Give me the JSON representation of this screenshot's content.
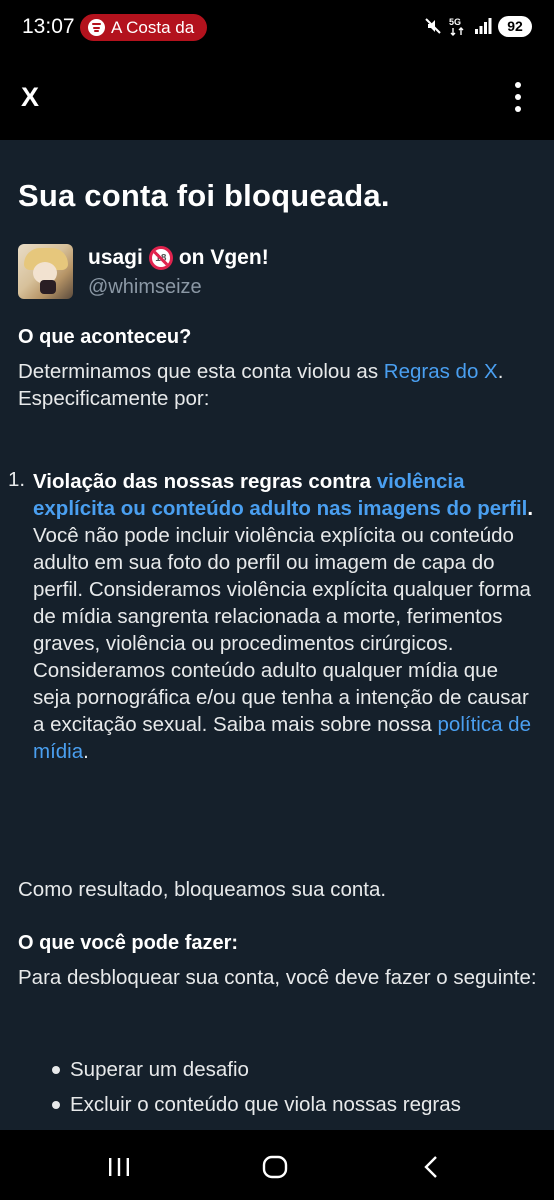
{
  "status_bar": {
    "time": "13:07",
    "media_app": "A Costa da",
    "network_label": "5G",
    "battery": "92",
    "icons": [
      "spotify-icon",
      "mute-icon",
      "5g-icon",
      "signal-icon",
      "battery-icon"
    ]
  },
  "header": {
    "close_label": "X",
    "menu_icon": "more-vert-icon"
  },
  "page": {
    "title": "Sua conta foi bloqueada."
  },
  "account": {
    "name": "usagi",
    "name_suffix": "on Vgen!",
    "emoji_icon": "no-under-18-icon",
    "emoji_text": "18",
    "handle": "@whimseize"
  },
  "what_happened": {
    "heading": "O que aconteceu?",
    "text_before": "Determinamos que esta conta violou as ",
    "link": "Regras do X",
    "text_after": ". Especificamente por:"
  },
  "violation": {
    "number": "1.",
    "title_text": "Violação das nossas regras contra ",
    "title_link": "violência explícita ou conteúdo adulto nas imagens do perfil",
    "title_end": ".",
    "description": "Você não pode incluir violência explícita ou conteúdo adulto em sua foto do perfil ou imagem de capa do perfil. Consideramos violência explícita qualquer forma de mídia sangrenta relacionada a morte, ferimentos graves, violência ou procedimentos cirúrgicos. Consideramos conteúdo adulto qualquer mídia que seja pornográfica e/ou que tenha a intenção de causar a excitação sexual. Saiba mais sobre nossa ",
    "desc_link": "política de mídia",
    "desc_end": "."
  },
  "result": {
    "text": "Como resultado, bloqueamos sua conta."
  },
  "what_you_can_do": {
    "heading": "O que você pode fazer:",
    "text": "Para desbloquear sua conta, você deve fazer o seguinte:",
    "bullets": [
      "Superar um desafio",
      "Excluir o conteúdo que viola nossas regras"
    ]
  },
  "colors": {
    "background": "#15202b",
    "link": "#4a9ff0",
    "spotify_pill": "#b3121d"
  },
  "nav_bar": {
    "icons": [
      "recent-apps-icon",
      "home-icon",
      "back-icon"
    ]
  }
}
